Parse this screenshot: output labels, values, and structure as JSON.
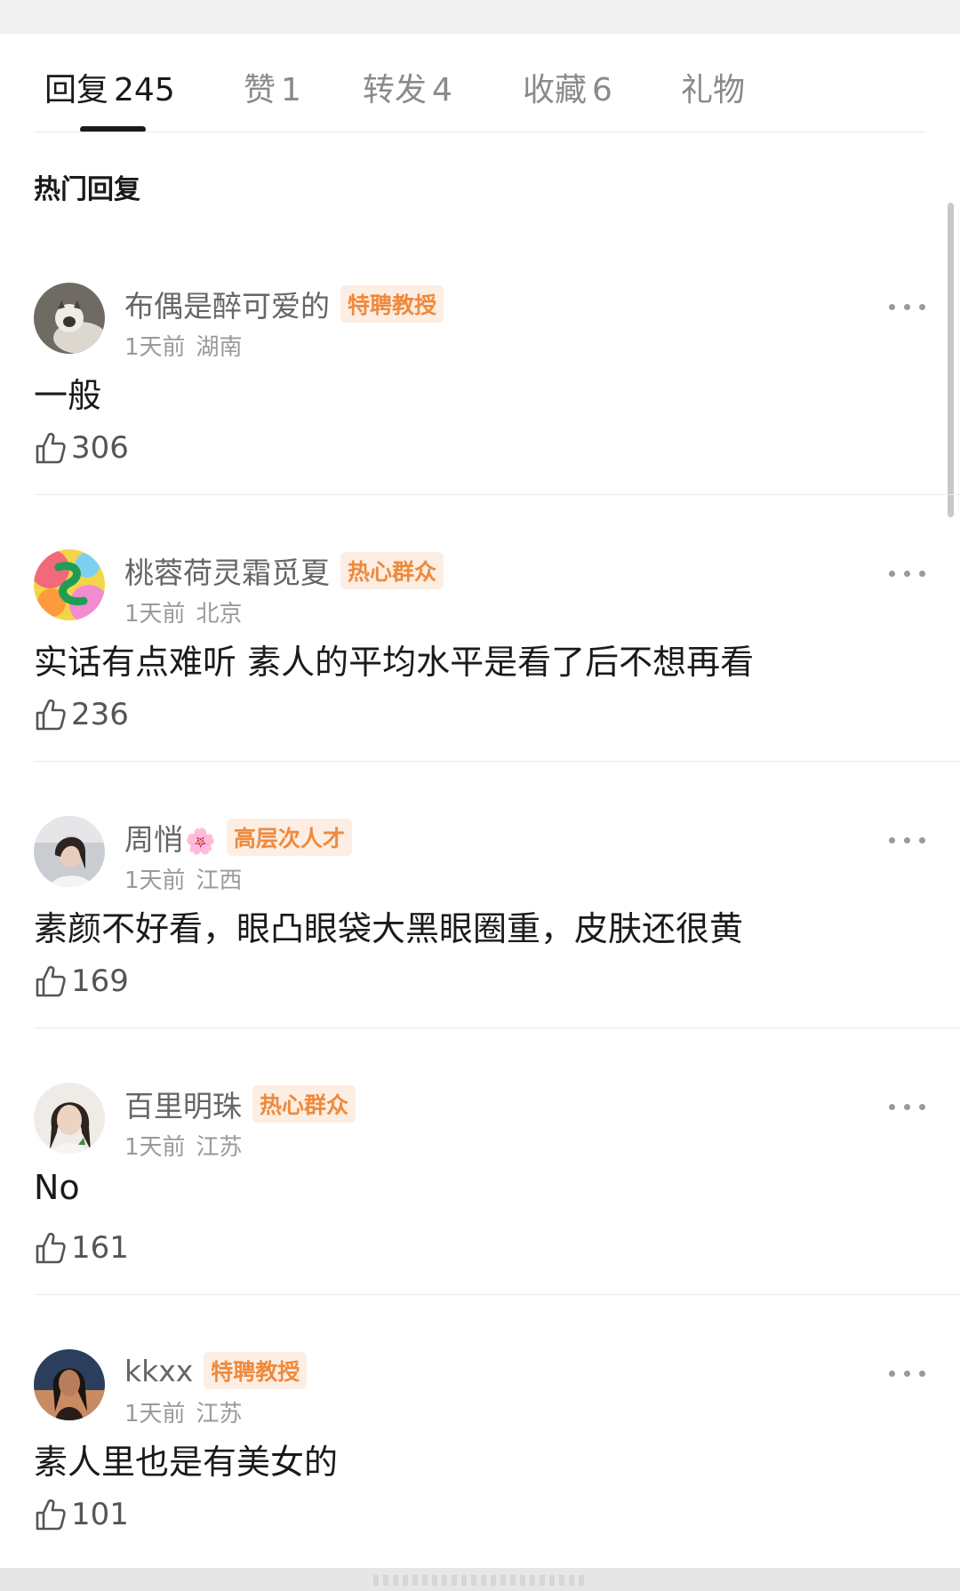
{
  "tabs": [
    {
      "label": "回复",
      "count": "245"
    },
    {
      "label": "赞",
      "count": "1"
    },
    {
      "label": "转发",
      "count": "4"
    },
    {
      "label": "收藏",
      "count": "6"
    },
    {
      "label": "礼物",
      "count": ""
    }
  ],
  "section_title": "热门回复",
  "comments": [
    {
      "username": "布偶是醉可爱的",
      "badge": "特聘教授",
      "time": "1天前",
      "location": "湖南",
      "text": "一般",
      "likes": "306"
    },
    {
      "username": "桃蓉荷灵霜觅夏",
      "badge": "热心群众",
      "time": "1天前",
      "location": "北京",
      "text": "实话有点难听 素人的平均水平是看了后不想再看",
      "likes": "236"
    },
    {
      "username": "周悄",
      "flower": "🌸",
      "badge": "高层次人才",
      "time": "1天前",
      "location": "江西",
      "text": "素颜不好看，眼凸眼袋大黑眼圈重，皮肤还很黄",
      "likes": "169"
    },
    {
      "username": "百里明珠",
      "badge": "热心群众",
      "time": "1天前",
      "location": "江苏",
      "text": "No",
      "likes": "161"
    },
    {
      "username": "kkxx",
      "badge": "特聘教授",
      "time": "1天前",
      "location": "江苏",
      "text": "素人里也是有美女的",
      "likes": "101"
    }
  ],
  "icons": {
    "like": "thumbs-up-icon",
    "more": "more-dots-icon"
  },
  "colors": {
    "badge_text": "#ef8a3c",
    "badge_bg": "#fdeee4",
    "active_tab": "#1a1a1a",
    "inactive_tab": "#8a8a8a"
  }
}
